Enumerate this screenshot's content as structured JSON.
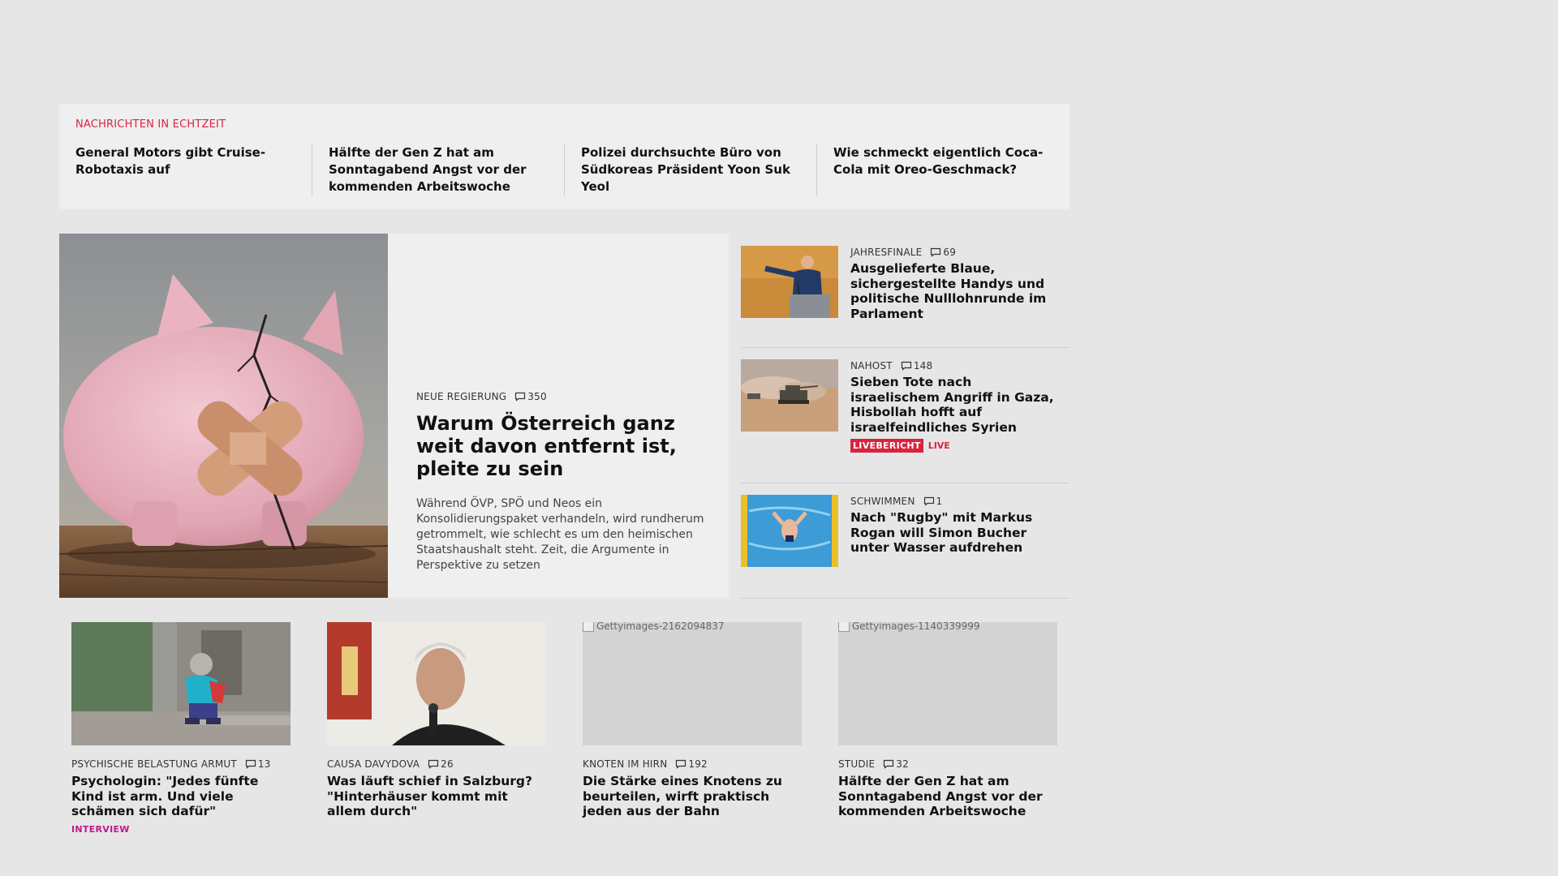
{
  "ticker": {
    "label": "NACHRICHTEN IN ECHTZEIT",
    "items": [
      "General Motors gibt Cruise-Robotaxis auf",
      "Hälfte der Gen Z hat am Sonntag­abend Angst vor der kommenden Arbeitswoche",
      "Polizei durchsuchte Büro von Südko­reas Präsident Yoon Suk Yeol",
      "Wie schmeckt eigentlich Coca-Cola mit Oreo-Geschmack?"
    ]
  },
  "hero": {
    "kicker": "NEUE REGIERUNG",
    "comments": "350",
    "title": "Warum Österreich ganz weit davon entfernt ist, pleite zu sein",
    "teaser": "Während ÖVP, SPÖ und Neos ein Konsolidierungspa­ket verhandeln, wird rundherum getrommelt, wie schlecht es um den heimischen Staatshaushalt steht. Zeit, die Argumente in Perspektive zu setzen",
    "image_icon": "piggy-bank-image"
  },
  "side": [
    {
      "kicker": "JAHRESFINALE",
      "comments": "69",
      "title": "Ausgelieferte Blaue, sicherge­stellte Handys und politische Nulllohnrunde im Parlament"
    },
    {
      "kicker": "NAHOST",
      "comments": "148",
      "title": "Sieben Tote nach israelischem Angriff in Gaza, Hisbollah hofft auf israelfeindliches Syrien",
      "badge": "LIVEBERICHT",
      "live": "LIVE"
    },
    {
      "kicker": "SCHWIMMEN",
      "comments": "1",
      "title": "Nach \"Rugby\" mit Markus Rogan will Simon Bucher unter Wasser aufdrehen"
    }
  ],
  "cards": [
    {
      "kicker": "PSYCHISCHE BELASTUNG ARMUT",
      "comments": "13",
      "title": "Psychologin: \"Jedes fünfte Kind ist arm. Und viele schämen sich dafür\"",
      "tag": "INTERVIEW"
    },
    {
      "kicker": "CAUSA DAVYDOVA",
      "comments": "26",
      "title": "Was läuft schief in Salzburg? \"Hinterhäuser kommt mit allem durch\""
    },
    {
      "kicker": "KNOTEN IM HIRN",
      "comments": "192",
      "title": "Die Stärke eines Knotens zu beurteilen, wirft praktisch jeden aus der Bahn",
      "alt": "Gettyimages-2162094837"
    },
    {
      "kicker": "STUDIE",
      "comments": "32",
      "title": "Hälfte der Gen Z hat am Sonntagabend Angst vor der kommenden Arbeitswoche",
      "alt": "Gettyimages-1140339999"
    }
  ],
  "colors": {
    "accent": "#d8243f",
    "interview": "#c2188a",
    "background": "#e6e6e6"
  }
}
